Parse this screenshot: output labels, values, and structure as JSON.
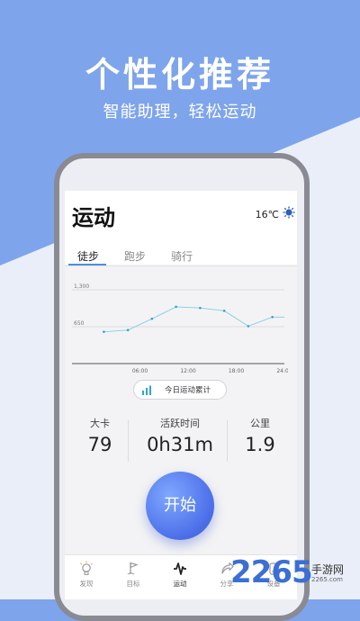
{
  "promo": {
    "headline": "个性化推荐",
    "subline": "智能助理，轻松运动"
  },
  "colors": {
    "background_blue": "#7ea4ec",
    "background_light": "#e9eef8",
    "accent": "#4a8fe0",
    "button_gradient_end": "#4b6ee8"
  },
  "app": {
    "title": "运动",
    "weather": {
      "temperature": "16℃",
      "icon": "sun-icon"
    },
    "tabs": [
      {
        "label": "徒步",
        "active": true
      },
      {
        "label": "跑步",
        "active": false
      },
      {
        "label": "骑行",
        "active": false
      }
    ],
    "summary_label": "今日运动累计",
    "metrics": [
      {
        "label": "大卡",
        "value": "79"
      },
      {
        "label": "活跃时间",
        "value": "0h31m"
      },
      {
        "label": "公里",
        "value": "1.9"
      }
    ],
    "start_label": "开始",
    "nav": [
      {
        "label": "发现",
        "icon": "lightbulb-icon",
        "active": false
      },
      {
        "label": "目标",
        "icon": "flag-icon",
        "active": false
      },
      {
        "label": "运动",
        "icon": "activity-icon",
        "active": true
      },
      {
        "label": "分享",
        "icon": "share-icon",
        "active": false
      },
      {
        "label": "设备",
        "icon": "device-icon",
        "active": false
      }
    ]
  },
  "chart_data": {
    "type": "line",
    "y_ticks": [
      "1,300",
      "650"
    ],
    "x_ticks": [
      "06:00",
      "12:00",
      "18:00",
      "24:00"
    ],
    "ylim": [
      0,
      1300
    ],
    "x": [
      1.5,
      4.5,
      7.5,
      10.5,
      13.5,
      16.5,
      19.5,
      22.5,
      24
    ],
    "values": [
      560,
      590,
      790,
      1000,
      980,
      930,
      660,
      820,
      820
    ],
    "grid": true
  },
  "watermark": {
    "number": "2265",
    "text": "手游网",
    "url": "2265.com"
  }
}
